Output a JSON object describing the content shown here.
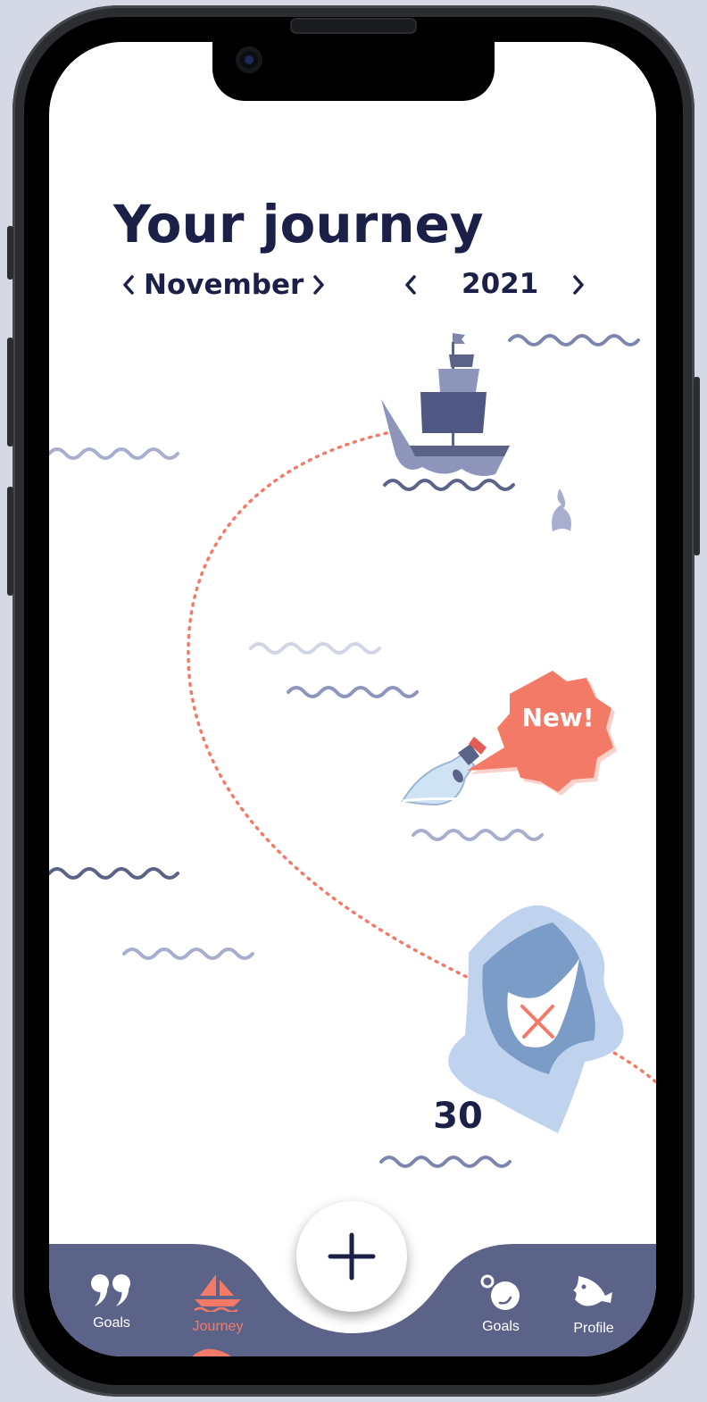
{
  "header": {
    "title": "Your journey",
    "month": "November",
    "year": "2021"
  },
  "map": {
    "bubble_text": "New!",
    "day_number": "30",
    "icons": [
      "ship-icon",
      "whale-tail-icon",
      "message-bottle-icon",
      "treasure-island-icon",
      "wave-icon"
    ]
  },
  "tabbar": {
    "items": [
      {
        "label": "Goals",
        "icon": "quote-icon",
        "active": false
      },
      {
        "label": "Journey",
        "icon": "sailboat-icon",
        "active": true
      },
      {
        "label": "Goals",
        "icon": "bubbles-icon",
        "active": false
      },
      {
        "label": "Profile",
        "icon": "fish-icon",
        "active": false
      }
    ],
    "add_button_icon": "plus-icon"
  },
  "colors": {
    "title": "#1b2048",
    "accent": "#f47a68",
    "tabbar": "#5c6388",
    "waves": "#7e86ad"
  }
}
